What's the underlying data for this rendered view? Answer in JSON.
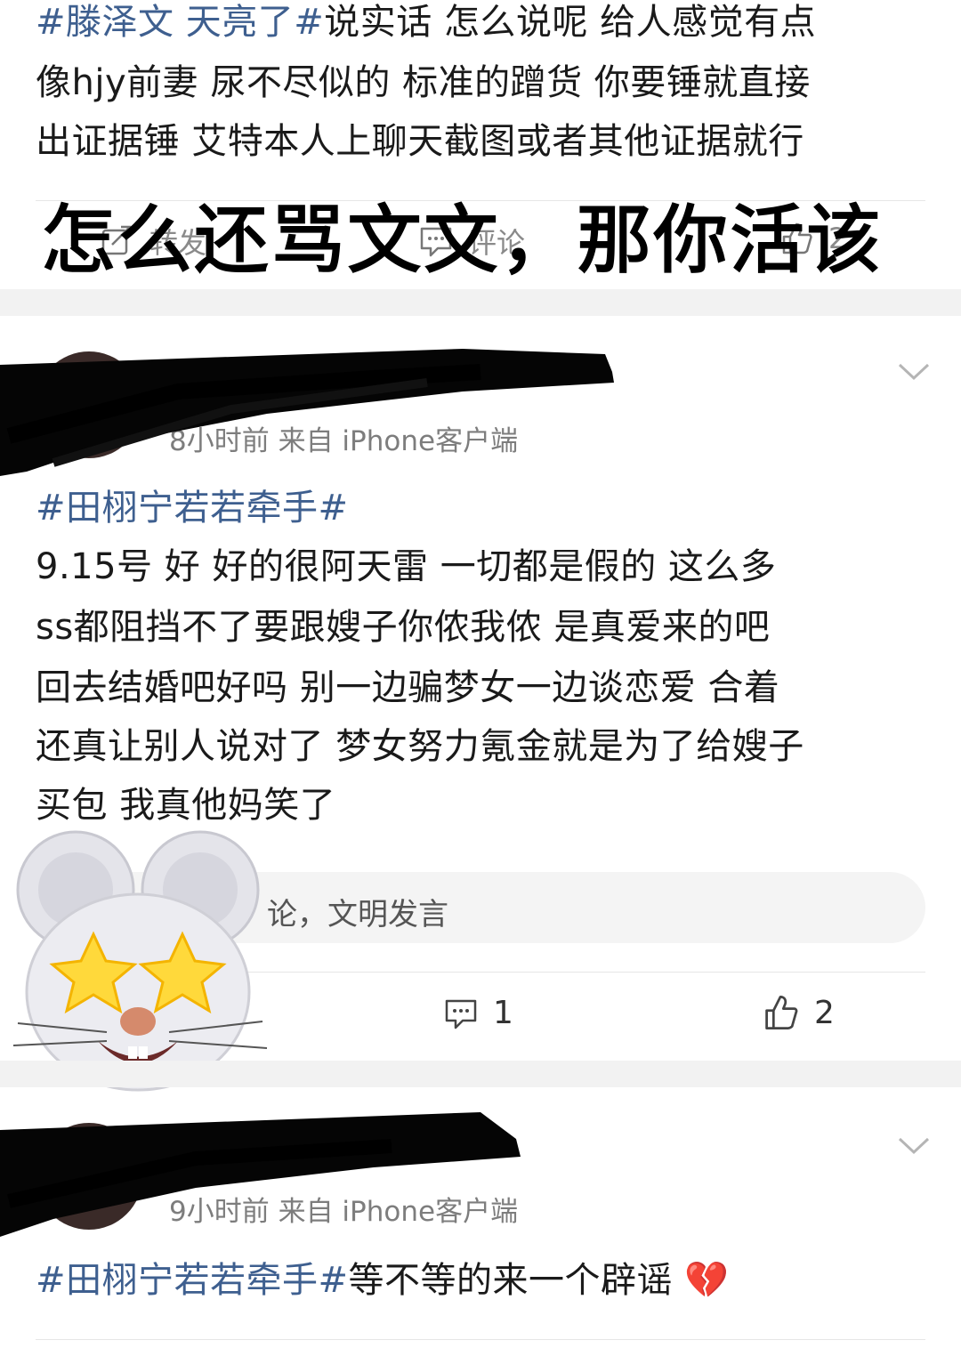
{
  "post1": {
    "lines": [
      {
        "tag": "#滕泽文 天亮了#",
        "text": "说实话  怎么说呢 给人感觉有点"
      },
      {
        "tag": "",
        "text": "像hjy前妻 尿不尽似的 标准的蹭货 你要锤就直接"
      },
      {
        "tag": "",
        "text": "出证据锤 艾特本人上聊天截图或者其他证据就行"
      }
    ],
    "actions": {
      "forward": "转发",
      "comment": "评论",
      "like_count": "2"
    },
    "overlay_caption": "怎么还骂文文，那你活该"
  },
  "post2": {
    "meta": "8小时前  来自 iPhone客户端",
    "tag_line": "#田栩宁若若牵手#",
    "body_lines": [
      "9.15号 好 好的很阿天雷  一切都是假的 这么多",
      " ss都阻挡不了要跟嫂子你侬我侬 是真爱来的吧",
      "回去结婚吧好吗 别一边骗梦女一边谈恋爱 合着",
      "还真让别人说对了 梦女努力氪金就是为了给嫂子",
      "买包 我真他妈笑了"
    ],
    "comment_placeholder": "论，文明发言",
    "comment_count": "1",
    "like_count": "2"
  },
  "post3": {
    "meta": "9小时前  来自 iPhone客户端",
    "tag": "#田栩宁若若牵手#",
    "text": "等不等的来一个辟谣",
    "emoji": "💔"
  },
  "colors": {
    "tag": "#3e5f8f",
    "band": "#f2f2f2",
    "meta": "#7d7d7d"
  },
  "icons": [
    "forward-icon",
    "comment-icon",
    "like-icon",
    "chevron-down-icon",
    "mouse-sticker",
    "scribble-redaction"
  ]
}
